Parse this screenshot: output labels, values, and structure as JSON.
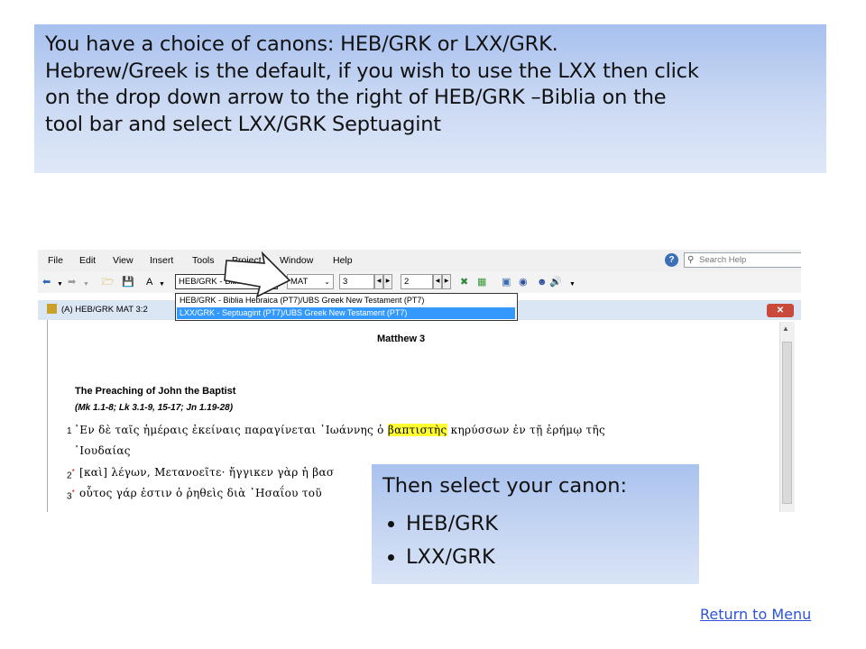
{
  "instructions": {
    "lines": [
      "You have a choice of canons: HEB/GRK or LXX/GRK.",
      "Hebrew/Greek is the default, if you wish to use the LXX then click",
      "on the drop down arrow to the right of HEB/GRK –Biblia on the",
      "tool bar and select LXX/GRK Septuagint"
    ]
  },
  "app": {
    "menu": [
      "File",
      "Edit",
      "View",
      "Insert",
      "Tools",
      "Project",
      "Window",
      "Help"
    ],
    "search_placeholder": "Search Help",
    "toolbar": {
      "canon_value": "HEB/GRK  - Biblia",
      "book_value": "MAT",
      "chapter_value": "3",
      "verse_value": "2"
    },
    "dropdown_options": [
      "HEB/GRK   - Biblia Hebraica (PT7)/UBS Greek New Testament (PT7)",
      "LXX/GRK   - Septuagint (PT7)/UBS Greek New Testament (PT7)"
    ],
    "window_title": "(A) HEB/GRK MAT 3:2",
    "document": {
      "chapter_heading": "Matthew 3",
      "section_heading": "The Preaching of John the Baptist",
      "parallel_refs": "(Mk 1.1-8; Lk 3.1-9, 15-17; Jn 1.19-28)",
      "verses": [
        {
          "num": "1",
          "marker": "",
          "before": "᾿Εν δὲ ταῖς ἡμέραις ἐκείναις παραγίνεται ᾿Ιωάννης ὁ ",
          "highlight": "βαπτιστὴς",
          "after": " κηρύσσων ἐν τῇ ἐρήμῳ τῆς"
        },
        {
          "num": "",
          "marker": "",
          "before": "᾿Ιουδαίας",
          "highlight": "",
          "after": ""
        },
        {
          "num": "2",
          "marker": "*",
          "before": "[καὶ] λέγων, Μετανοεῖτε· ἤγγικεν γὰρ ἡ βασ",
          "highlight": "",
          "after": ""
        },
        {
          "num": "3",
          "marker": "*",
          "before": "οὗτος γάρ ἐστιν ὁ ῥηθεὶς διὰ ᾿Ησαΐου τοῦ",
          "highlight": "",
          "after": ""
        }
      ]
    }
  },
  "callout": {
    "heading": "Then select your canon:",
    "items": [
      "HEB/GRK",
      "LXX/GRK"
    ]
  },
  "return_link": "Return to Menu"
}
